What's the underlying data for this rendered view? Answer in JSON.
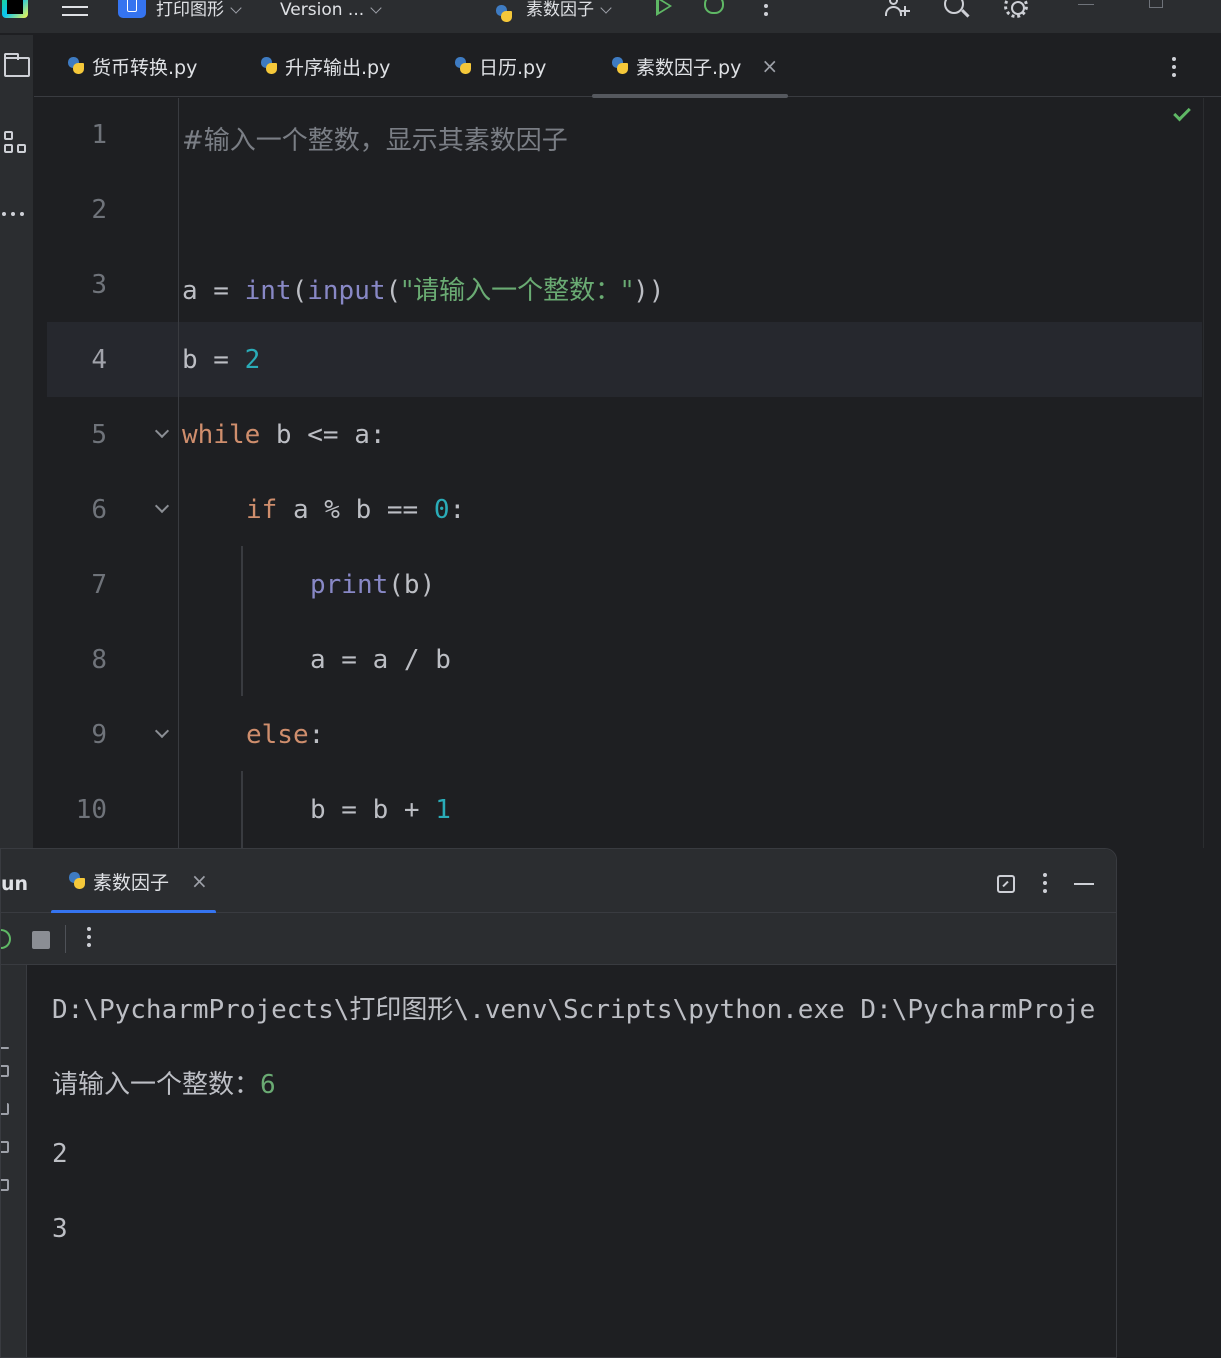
{
  "titlebar": {
    "project_name": "打印图形",
    "vcs_label": "Version ...",
    "run_config": "素数因子"
  },
  "editor_tabs": [
    {
      "label": "货币转换.py"
    },
    {
      "label": "升序输出.py"
    },
    {
      "label": "日历.py"
    },
    {
      "label": "素数因子.py",
      "active": true
    }
  ],
  "editor": {
    "line_numbers": [
      "1",
      "2",
      "3",
      "4",
      "5",
      "6",
      "7",
      "8",
      "9",
      "10"
    ],
    "current_line": "4",
    "lines": {
      "l1_comment": "#输入一个整数，显示其素数因子",
      "l3": {
        "var": "a",
        "eq": " = ",
        "int": "int",
        "open1": "(",
        "input": "input",
        "open2": "(",
        "str": "\"请输入一个整数：\"",
        "close": "))"
      },
      "l4": {
        "var": "b",
        "eq": " = ",
        "num": "2"
      },
      "l5": {
        "kw": "while",
        "rest": " b <= a:"
      },
      "l6": {
        "kw": "if",
        "rest": " a % b == ",
        "num": "0",
        "colon": ":"
      },
      "l7": {
        "print": "print",
        "rest": "(b)"
      },
      "l8": {
        "text": "a = a / b"
      },
      "l9": {
        "kw": "else",
        "colon": ":"
      },
      "l10": {
        "text": "b = b + ",
        "num": "1"
      }
    }
  },
  "run_panel": {
    "title": "un",
    "tab_label": "素数因子",
    "output": {
      "cmd_path": "D:\\PycharmProjects\\",
      "cmd_cjk": "打印图形",
      "cmd_rest": "\\.venv\\Scripts\\python.exe D:\\PycharmProje",
      "prompt": "请输入一个整数：",
      "user_input": "6",
      "result_lines": [
        "2",
        "3"
      ]
    }
  },
  "colors": {
    "background": "#1e1f22",
    "panel": "#2b2d30",
    "keyword": "#cf8e6d",
    "builtin": "#8888c6",
    "string": "#6aab73",
    "number": "#2aacb8",
    "accent": "#3574f0",
    "run_green": "#5fb865"
  }
}
